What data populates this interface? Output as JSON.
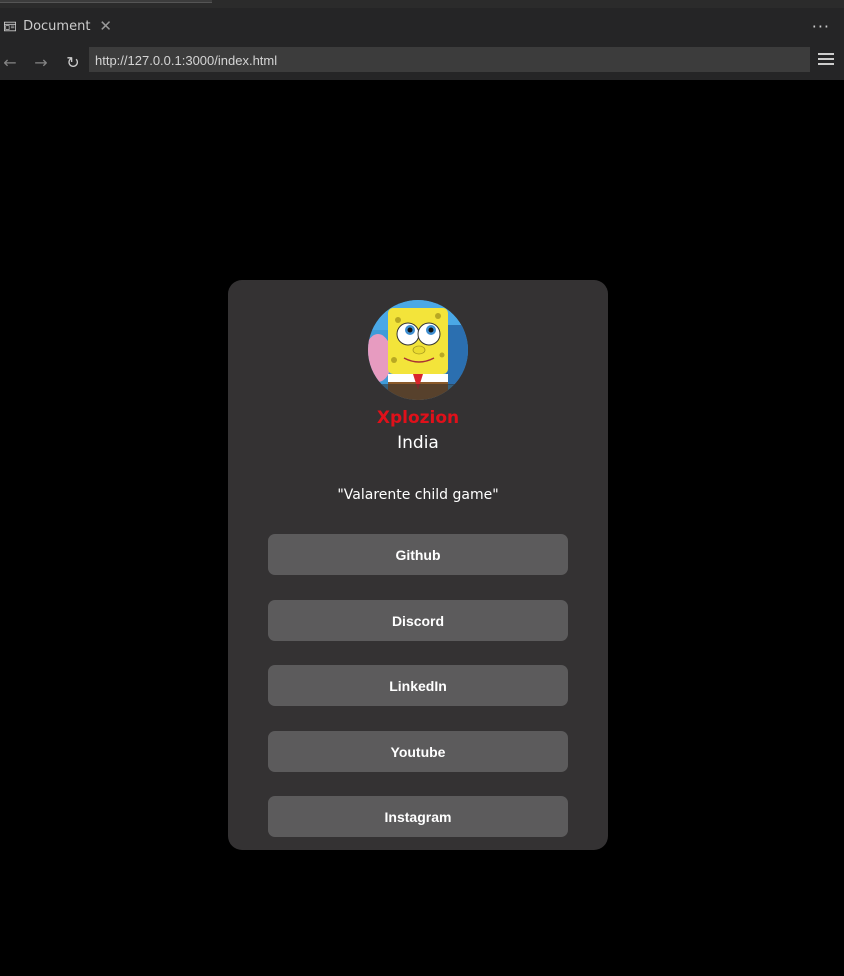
{
  "browser": {
    "tab_title": "Document",
    "tab_close": "✕",
    "more": "···",
    "back": "←",
    "forward": "→",
    "reload": "↻",
    "url": "http://127.0.0.1:3000/index.html"
  },
  "profile": {
    "avatar_icon": "spongebob-avatar",
    "name": "Xplozion",
    "location": "India",
    "bio": "\"Valarente child game\""
  },
  "links": [
    {
      "label": "Github"
    },
    {
      "label": "Discord"
    },
    {
      "label": "LinkedIn"
    },
    {
      "label": "Youtube"
    },
    {
      "label": "Instagram"
    }
  ],
  "colors": {
    "page_bg": "#000000",
    "card_bg": "#343233",
    "button_bg": "#5c5b5c",
    "name_color": "#e0101a"
  }
}
